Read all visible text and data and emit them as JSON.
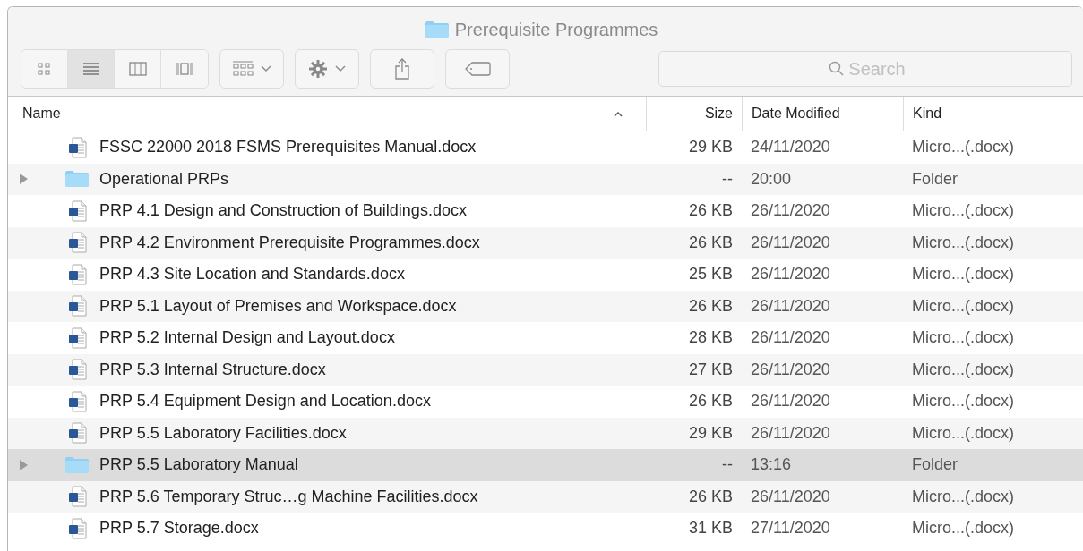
{
  "window": {
    "title": "Prerequisite Programmes"
  },
  "view_modes": [
    {
      "kind": "icons",
      "selected": false
    },
    {
      "kind": "list",
      "selected": true
    },
    {
      "kind": "columns",
      "selected": false
    },
    {
      "kind": "gallery",
      "selected": false
    }
  ],
  "search": {
    "placeholder": "Search"
  },
  "table": {
    "columns": [
      {
        "label": "Name",
        "sorted": true
      },
      {
        "label": "Size",
        "sorted": false
      },
      {
        "label": "Date Modified",
        "sorted": false
      },
      {
        "label": "Kind",
        "sorted": false
      }
    ],
    "rows": [
      {
        "kind": "file",
        "name": "FSSC 22000 2018 FSMS Prerequisites Manual.docx",
        "size": "29 KB",
        "date": "24/11/2020",
        "type": "Micro...(.docx)",
        "selected": false
      },
      {
        "kind": "folder",
        "name": "Operational PRPs",
        "size": "--",
        "date": "20:00",
        "type": "Folder",
        "selected": false,
        "expanded": false
      },
      {
        "kind": "file",
        "name": "PRP 4.1 Design and Construction of Buildings.docx",
        "size": "26 KB",
        "date": "26/11/2020",
        "type": "Micro...(.docx)",
        "selected": false
      },
      {
        "kind": "file",
        "name": "PRP 4.2 Environment Prerequisite Programmes.docx",
        "size": "26 KB",
        "date": "26/11/2020",
        "type": "Micro...(.docx)",
        "selected": false
      },
      {
        "kind": "file",
        "name": "PRP 4.3 Site Location and Standards.docx",
        "size": "25 KB",
        "date": "26/11/2020",
        "type": "Micro...(.docx)",
        "selected": false
      },
      {
        "kind": "file",
        "name": "PRP 5.1 Layout of Premises and Workspace.docx",
        "size": "26 KB",
        "date": "26/11/2020",
        "type": "Micro...(.docx)",
        "selected": false
      },
      {
        "kind": "file",
        "name": "PRP 5.2 Internal Design and Layout.docx",
        "size": "28 KB",
        "date": "26/11/2020",
        "type": "Micro...(.docx)",
        "selected": false
      },
      {
        "kind": "file",
        "name": "PRP 5.3 Internal Structure.docx",
        "size": "27 KB",
        "date": "26/11/2020",
        "type": "Micro...(.docx)",
        "selected": false
      },
      {
        "kind": "file",
        "name": "PRP 5.4 Equipment Design and Location.docx",
        "size": "26 KB",
        "date": "26/11/2020",
        "type": "Micro...(.docx)",
        "selected": false
      },
      {
        "kind": "file",
        "name": "PRP 5.5 Laboratory Facilities.docx",
        "size": "29 KB",
        "date": "26/11/2020",
        "type": "Micro...(.docx)",
        "selected": false
      },
      {
        "kind": "folder",
        "name": "PRP 5.5 Laboratory Manual",
        "size": "--",
        "date": "13:16",
        "type": "Folder",
        "selected": true,
        "expanded": false
      },
      {
        "kind": "file",
        "name": "PRP 5.6 Temporary Struc…g Machine Facilities.docx",
        "size": "26 KB",
        "date": "26/11/2020",
        "type": "Micro...(.docx)",
        "selected": false
      },
      {
        "kind": "file",
        "name": "PRP 5.7 Storage.docx",
        "size": "31 KB",
        "date": "27/11/2020",
        "type": "Micro...(.docx)",
        "selected": false
      }
    ]
  }
}
